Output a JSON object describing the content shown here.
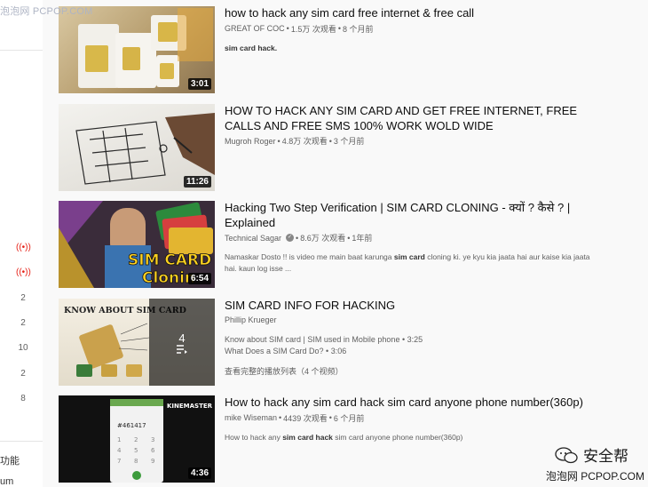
{
  "watermark": {
    "top": "泡泡网 PCPOP.COM",
    "bottom": "泡泡网 PCPOP.COM",
    "brand": "安全帮"
  },
  "sidebar": {
    "live_icon": "((•))",
    "counts": [
      "2",
      "2",
      "10",
      "2",
      "8"
    ],
    "text_bottom1": "功能",
    "text_bottom2": "um"
  },
  "results": [
    {
      "title": "how to hack any sim card free internet & free call",
      "channel": "GREAT OF COC",
      "views": "1.5万 次观看",
      "age": "8 个月前",
      "description": "sim card hack.",
      "duration": "3:01"
    },
    {
      "title": "HOW TO HACK ANY SIM CARD AND GET FREE INTERNET, FREE CALLS AND FREE SMS 100% WORK WOLD WIDE",
      "channel": "Mugroh Roger",
      "views": "4.8万 次观看",
      "age": "3 个月前",
      "duration": "11:26"
    },
    {
      "title": "Hacking Two Step Verification | SIM CARD CLONING - क्यों ? कैसे ? | Explained",
      "channel": "Technical Sagar",
      "views": "8.6万 次观看",
      "age": "1年前",
      "description_pre": "Namaskar Dosto !! is video me main baat karunga ",
      "description_bold": "sim card",
      "description_post": " cloning ki. ye kyu kia jaata hai aur kaise kia jaata hai. kaun log isse ...",
      "duration": "6:54",
      "thumb_text1": "SIM CARD",
      "thumb_text2": "Clonin"
    },
    {
      "title": "SIM CARD INFO FOR HACKING",
      "channel": "Phillip Krueger",
      "playlist_item1": "Know about SIM card | SIM used in Mobile phone • 3:25",
      "playlist_item2": "What Does a SIM Card Do? • 3:06",
      "playlist_link": "查看完整的播放列表（4 个视频）",
      "playlist_count": "4",
      "thumb_text": "KNOW ABOUT SIM CARD"
    },
    {
      "title": "How to hack any sim card hack sim card anyone phone number(360p)",
      "channel": "mike Wiseman",
      "views": "4439 次观看",
      "age": "6 个月前",
      "description_pre": "How to hack any ",
      "description_bold": "sim card hack",
      "description_post": " sim card anyone phone number(360p)",
      "duration": "4:36",
      "thumb_brand": "KINEMASTER",
      "thumb_number": "#461417"
    }
  ],
  "separator": " • "
}
